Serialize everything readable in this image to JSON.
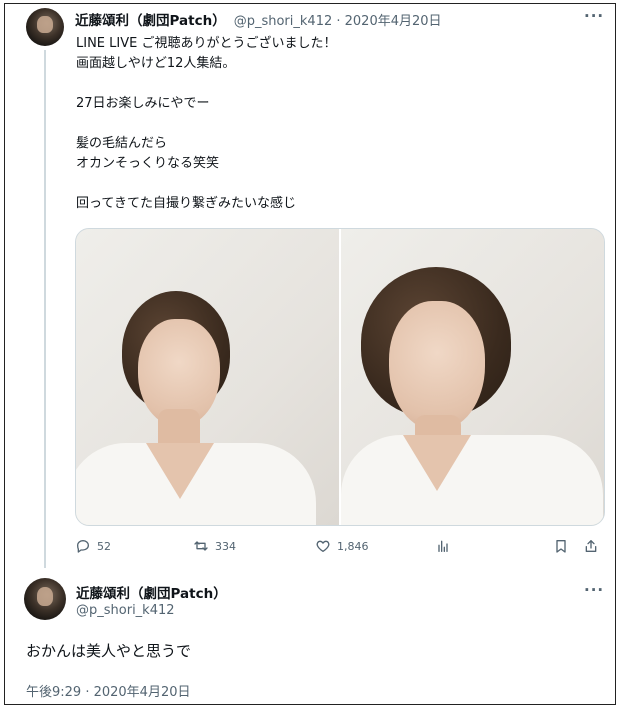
{
  "tweet": {
    "author_name": "近藤頌利（劇団Patch）",
    "meta": "@p_shori_k412 · 2020年4月20日",
    "lines": [
      "LINE LIVE ご視聴ありがとうございました！",
      "画面越しやけど12人集結。",
      "",
      "27日お楽しみにやでー",
      "",
      "髪の毛結んだら",
      "オカンそっくりなる笑笑",
      "",
      "回ってきてた自撮り繋ぎみたいな感じ"
    ],
    "reply_count": "52",
    "retweet_count": "334",
    "like_count": "1,846"
  },
  "reply": {
    "author_name": "近藤頌利（劇団Patch）",
    "handle": "@p_shori_k412",
    "text": "おかんは美人やと思うで",
    "timestamp": "午後9:29 · 2020年4月20日"
  },
  "icons": {
    "more": "more-dots-icon",
    "reply": "reply-icon",
    "retweet": "retweet-icon",
    "like": "heart-icon",
    "views": "analytics-icon",
    "bookmark": "bookmark-icon",
    "share": "share-icon"
  },
  "colors": {
    "text": "#0f1419",
    "secondary": "#536471",
    "thread_line": "#cfd9de"
  }
}
